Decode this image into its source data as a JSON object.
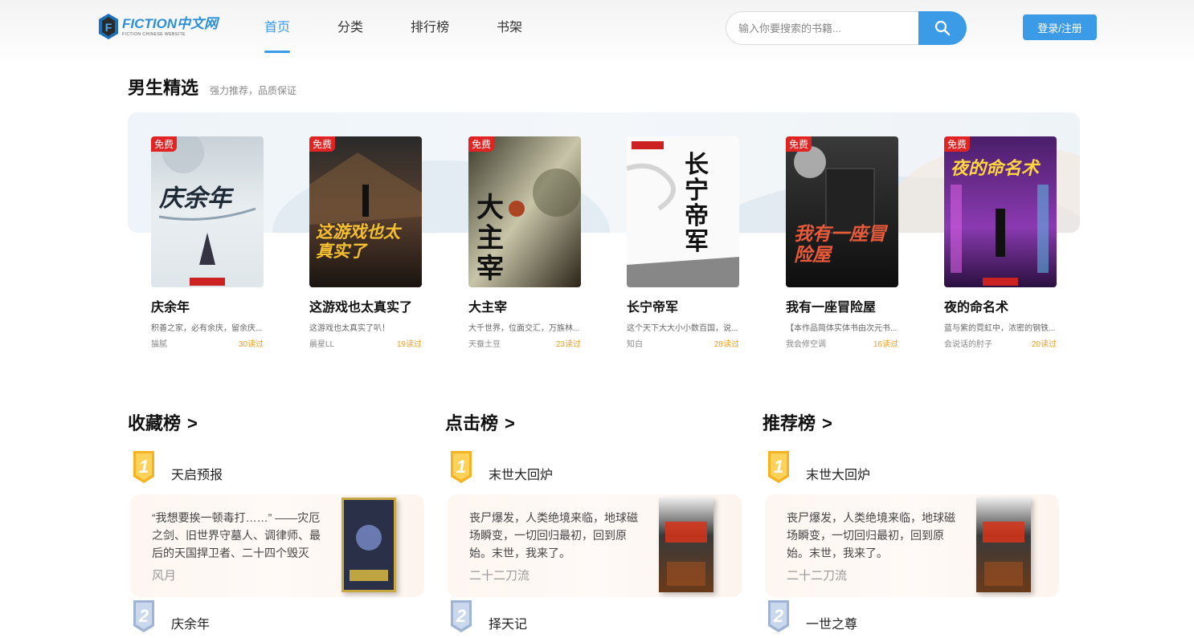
{
  "header": {
    "logo_main": "FICTION中文网",
    "logo_sub": "FICTION CHINESE WEBSITE",
    "nav": [
      {
        "label": "首页",
        "active": true
      },
      {
        "label": "分类",
        "active": false
      },
      {
        "label": "排行榜",
        "active": false
      },
      {
        "label": "书架",
        "active": false
      }
    ],
    "search_placeholder": "输入你要搜索的书籍...",
    "login_label": "登录/注册",
    "accent_color": "#3c9be6"
  },
  "featured": {
    "title": "男生精选",
    "subtitle": "强力推荐，品质保证",
    "books": [
      {
        "title": "庆余年",
        "desc": "积善之家，必有余庆，留余庆...",
        "author": "猫腻",
        "reads": "30读过",
        "badge": "免费",
        "cover_text": "庆余年"
      },
      {
        "title": "这游戏也太真实了",
        "desc": "这游戏也太真实了叭！",
        "author": "晨星LL",
        "reads": "19读过",
        "badge": "免费",
        "cover_text": "这游戏也太真实了"
      },
      {
        "title": "大主宰",
        "desc": "大千世界，位面交汇，万族林...",
        "author": "天蚕土豆",
        "reads": "23读过",
        "badge": "免费",
        "cover_text": "大主宰"
      },
      {
        "title": "长宁帝军",
        "desc": "这个天下大大小小数百国，说...",
        "author": "知白",
        "reads": "28读过",
        "badge": "",
        "cover_text": "长宁帝军"
      },
      {
        "title": "我有一座冒险屋",
        "desc": "【本作品简体实体书由次元书...",
        "author": "我会修空调",
        "reads": "16读过",
        "badge": "免费",
        "cover_text": "我有一座冒险屋"
      },
      {
        "title": "夜的命名术",
        "desc": "蓝与紫的霓虹中，浓密的钢铁...",
        "author": "会说话的肘子",
        "reads": "20读过",
        "badge": "免费",
        "cover_text": "夜的命名术"
      }
    ]
  },
  "rankings": [
    {
      "title": "收藏榜",
      "arrow": ">",
      "first": {
        "rank": "1",
        "name": "天启预报",
        "desc": "“我想要挨一顿毒打……” ——灾厄之剑、旧世界守墓人、调律师、最后的天国捍卫者、二十四个毁灭",
        "author": "风月"
      },
      "second": {
        "rank": "2",
        "name": "庆余年"
      }
    },
    {
      "title": "点击榜",
      "arrow": ">",
      "first": {
        "rank": "1",
        "name": "末世大回炉",
        "desc": "丧尸爆发，人类绝境来临，地球磁场瞬变，一切回归最初，回到原始。末世，我来了。",
        "author": "二十二刀流"
      },
      "second": {
        "rank": "2",
        "name": "择天记"
      }
    },
    {
      "title": "推荐榜",
      "arrow": ">",
      "first": {
        "rank": "1",
        "name": "末世大回炉",
        "desc": "丧尸爆发，人类绝境来临，地球磁场瞬变，一切回归最初，回到原始。末世，我来了。",
        "author": "二十二刀流"
      },
      "second": {
        "rank": "2",
        "name": "一世之尊"
      }
    }
  ]
}
